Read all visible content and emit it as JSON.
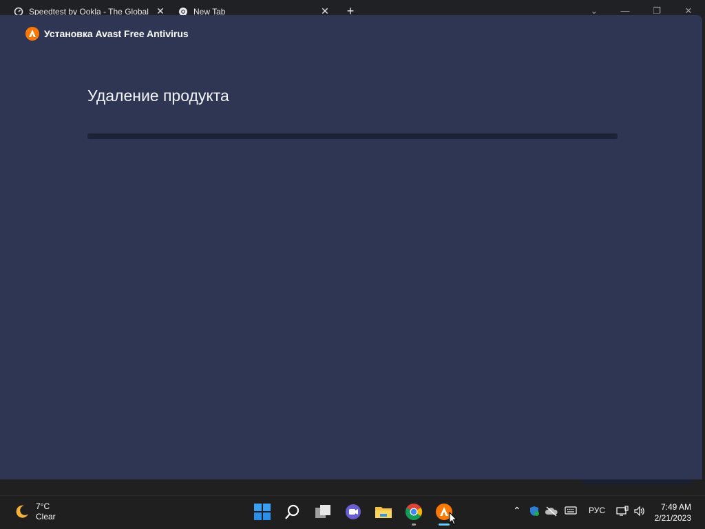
{
  "browser": {
    "tabs": [
      {
        "label": "Speedtest by Ookla - The Global",
        "icon": "speedometer-icon"
      },
      {
        "label": "New Tab",
        "icon": "chrome-icon"
      }
    ],
    "new_tab_symbol": "+",
    "close_symbol": "✕"
  },
  "installer": {
    "title": "Установка Avast Free Antivirus",
    "heading": "Удаление продукта",
    "progress_fraction": 0,
    "colors": {
      "background": "#2e3654",
      "accent": "#ff7800",
      "track": "#1d2336"
    }
  },
  "taskbar": {
    "weather": {
      "temp": "7°C",
      "condition": "Clear"
    },
    "apps": [
      "start-icon",
      "search-icon",
      "task-view-icon",
      "teams-chat-icon",
      "file-explorer-icon",
      "chrome-icon",
      "avast-icon"
    ],
    "language": "РУС",
    "clock": {
      "time": "7:49 AM",
      "date": "2/21/2023"
    }
  }
}
